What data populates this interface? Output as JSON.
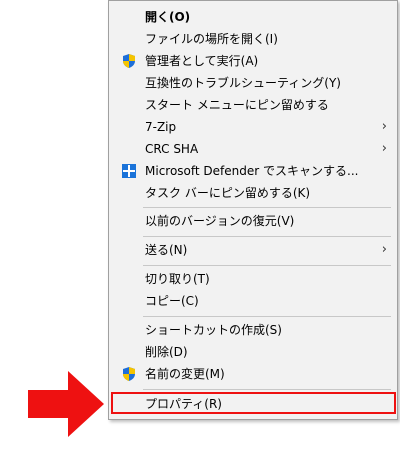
{
  "menu": {
    "items": [
      {
        "label": "開く(O)"
      },
      {
        "label": "ファイルの場所を開く(I)"
      },
      {
        "label": "管理者として実行(A)",
        "icon": "uac-shield-icon"
      },
      {
        "label": "互換性のトラブルシューティング(Y)"
      },
      {
        "label": "スタート メニューにピン留めする"
      },
      {
        "label": "7-Zip",
        "submenu": true
      },
      {
        "label": "CRC SHA",
        "submenu": true
      },
      {
        "label": "Microsoft Defender でスキャンする...",
        "icon": "defender-icon"
      },
      {
        "label": "タスク バーにピン留めする(K)"
      },
      {
        "label": "以前のバージョンの復元(V)"
      },
      {
        "label": "送る(N)",
        "submenu": true
      },
      {
        "label": "切り取り(T)"
      },
      {
        "label": "コピー(C)"
      },
      {
        "label": "ショートカットの作成(S)"
      },
      {
        "label": "削除(D)"
      },
      {
        "label": "名前の変更(M)",
        "icon": "uac-shield-icon"
      },
      {
        "label": "プロパティ(R)"
      }
    ],
    "submenu_glyph": "›"
  },
  "colors": {
    "menu_bg": "#f2f2f2",
    "highlight_border": "#ee1111",
    "arrow": "#ee1111",
    "shield_blue": "#1e6fd9",
    "shield_yellow": "#f5c400",
    "defender_blue": "#1a73d9"
  }
}
